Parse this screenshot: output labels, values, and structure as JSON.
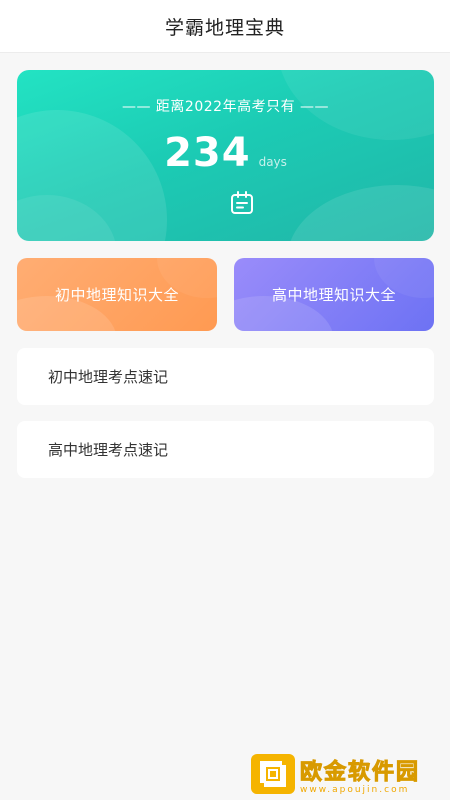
{
  "header": {
    "title": "学霸地理宝典"
  },
  "countdown": {
    "label": "—— 距离2022年高考只有 ——",
    "value": "234",
    "unit": "days",
    "icon": "calendar-icon"
  },
  "cards": [
    {
      "label": "初中地理知识大全",
      "color": "#ffa45f"
    },
    {
      "label": "高中地理知识大全",
      "color": "#7f7ff7"
    }
  ],
  "list": [
    {
      "label": "初中地理考点速记"
    },
    {
      "label": "高中地理考点速记"
    }
  ],
  "watermark": {
    "title": "欧金软件园",
    "url": "www.apoujin.com",
    "color": "#f5b400"
  }
}
